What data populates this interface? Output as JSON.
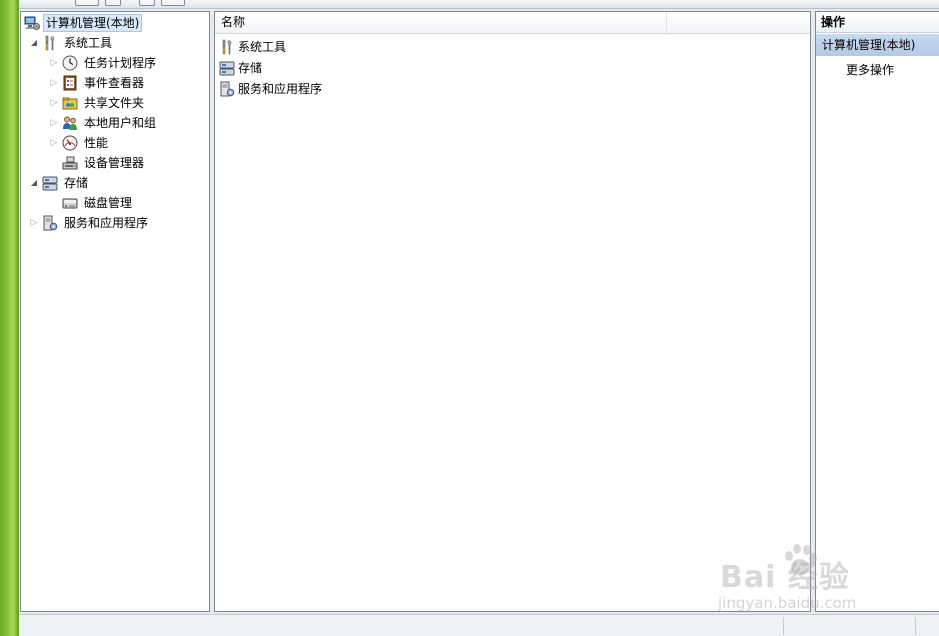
{
  "tree": {
    "root": "计算机管理(本地)",
    "system_tools": "系统工具",
    "task_scheduler": "任务计划程序",
    "event_viewer": "事件查看器",
    "shared_folders": "共享文件夹",
    "local_users": "本地用户和组",
    "performance": "性能",
    "device_manager": "设备管理器",
    "storage": "存储",
    "disk_management": "磁盘管理",
    "services_apps": "服务和应用程序"
  },
  "list": {
    "column_name": "名称",
    "rows": [
      "系统工具",
      "存储",
      "服务和应用程序"
    ]
  },
  "actions": {
    "header": "操作",
    "group": "计算机管理(本地)",
    "more": "更多操作"
  },
  "watermark": {
    "brand": "Bai  经验",
    "sub": "jingyan.baidu.com"
  },
  "icons": {
    "computer": "computer-management-icon",
    "tools": "system-tools-icon",
    "clock": "task-scheduler-icon",
    "event": "event-viewer-icon",
    "share": "shared-folders-icon",
    "users": "local-users-icon",
    "perf": "performance-icon",
    "device": "device-manager-icon",
    "storage": "storage-icon",
    "disk": "disk-management-icon",
    "services": "services-icon"
  }
}
